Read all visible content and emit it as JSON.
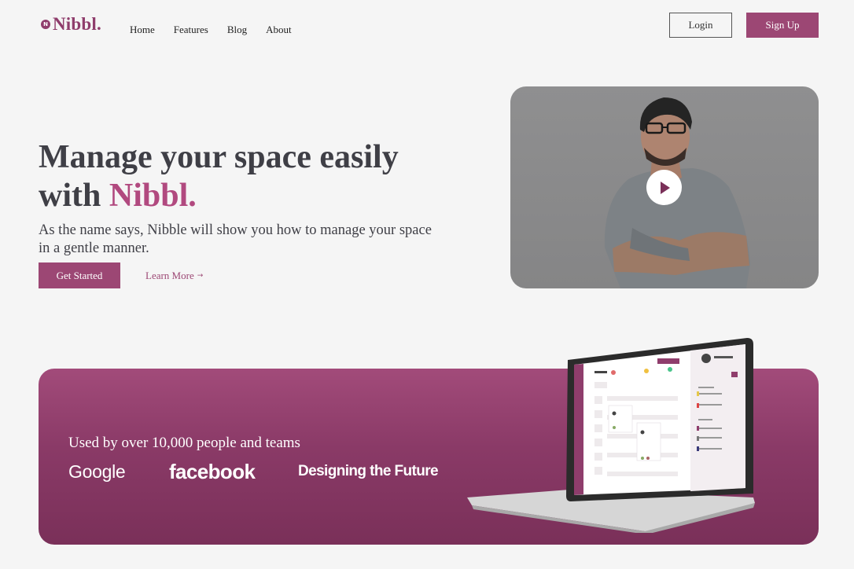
{
  "header": {
    "logo_text": "Nibbl.",
    "logo_mark": "N",
    "nav": [
      {
        "label": "Home"
      },
      {
        "label": "Features"
      },
      {
        "label": "Blog"
      },
      {
        "label": "About"
      }
    ],
    "login_label": "Login",
    "signup_label": "Sign Up"
  },
  "hero": {
    "title_line1": "Manage your space easily",
    "title_line2_prefix": "with ",
    "title_accent": "Nibbl.",
    "subtitle": "As the name says, Nibble will show you how to manage your space in a gentle manner.",
    "cta_label": "Get Started",
    "learn_more_label": "Learn More",
    "learn_more_arrow": "→"
  },
  "video": {
    "play_icon": "play-icon"
  },
  "banner": {
    "used_by_text": "Used by over 10,000 people and teams",
    "brands": [
      "Google",
      "facebook",
      "Designing the Future"
    ]
  },
  "colors": {
    "accent": "#9c4774",
    "accent_text": "#b1497f",
    "heading": "#3f3f46",
    "background": "#f5f5f5"
  }
}
